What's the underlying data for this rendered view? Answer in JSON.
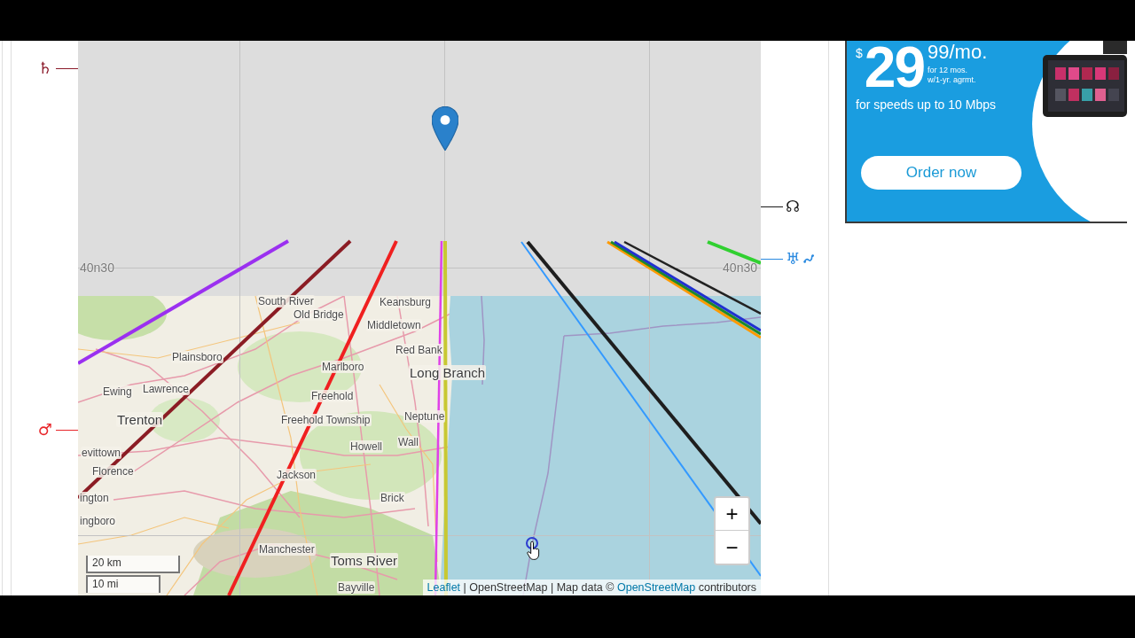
{
  "left_markers": [
    {
      "glyph": "♄",
      "color": "#8b1a2a"
    },
    {
      "glyph": "♂",
      "color": "#e8262a"
    }
  ],
  "map": {
    "grid_labels": [
      "40n30",
      "40n30"
    ],
    "place_labels": [
      {
        "text": "South River",
        "kind": "town"
      },
      {
        "text": "Keansburg",
        "kind": "town"
      },
      {
        "text": "Old Bridge",
        "kind": "town"
      },
      {
        "text": "Middletown",
        "kind": "town"
      },
      {
        "text": "Red Bank",
        "kind": "town"
      },
      {
        "text": "Plainsboro",
        "kind": "town"
      },
      {
        "text": "Marlboro",
        "kind": "town"
      },
      {
        "text": "Long Branch",
        "kind": "city"
      },
      {
        "text": "Ewing",
        "kind": "town"
      },
      {
        "text": "Lawrence",
        "kind": "town"
      },
      {
        "text": "Freehold",
        "kind": "town"
      },
      {
        "text": "Trenton",
        "kind": "city"
      },
      {
        "text": "Freehold Township",
        "kind": "town"
      },
      {
        "text": "Neptune",
        "kind": "town"
      },
      {
        "text": "Wall",
        "kind": "town"
      },
      {
        "text": "Howell",
        "kind": "town"
      },
      {
        "text": "evittown",
        "kind": "town"
      },
      {
        "text": "Florence",
        "kind": "town"
      },
      {
        "text": "Jackson",
        "kind": "town"
      },
      {
        "text": "ington",
        "kind": "town"
      },
      {
        "text": "Brick",
        "kind": "town"
      },
      {
        "text": "ingboro",
        "kind": "town"
      },
      {
        "text": "Manchester",
        "kind": "town"
      },
      {
        "text": "Toms River",
        "kind": "city"
      },
      {
        "text": "Bayville",
        "kind": "town"
      }
    ],
    "zoom_in": "+",
    "zoom_out": "−",
    "scale": [
      "20 km",
      "10 mi"
    ],
    "attribution": [
      {
        "kind": "link",
        "text": "Leaflet"
      },
      {
        "kind": "text",
        "text": " | OpenStreetMap | Map data © "
      },
      {
        "kind": "link",
        "text": "OpenStreetMap"
      },
      {
        "kind": "text",
        "text": " contributors"
      }
    ]
  },
  "right_markers": [
    {
      "glyph": "☊",
      "color": "#1a1a1a",
      "curl": false
    },
    {
      "glyph": "♅",
      "color": "#2a8ae0",
      "curl": true
    }
  ],
  "ad": {
    "currency": "$",
    "price": "29",
    "cents": "99/mo.",
    "term": "for 12 mos.",
    "agreement": "w/1-yr. agrmt.",
    "speed": "for speeds up to 10 Mbps",
    "button": "Order now"
  }
}
